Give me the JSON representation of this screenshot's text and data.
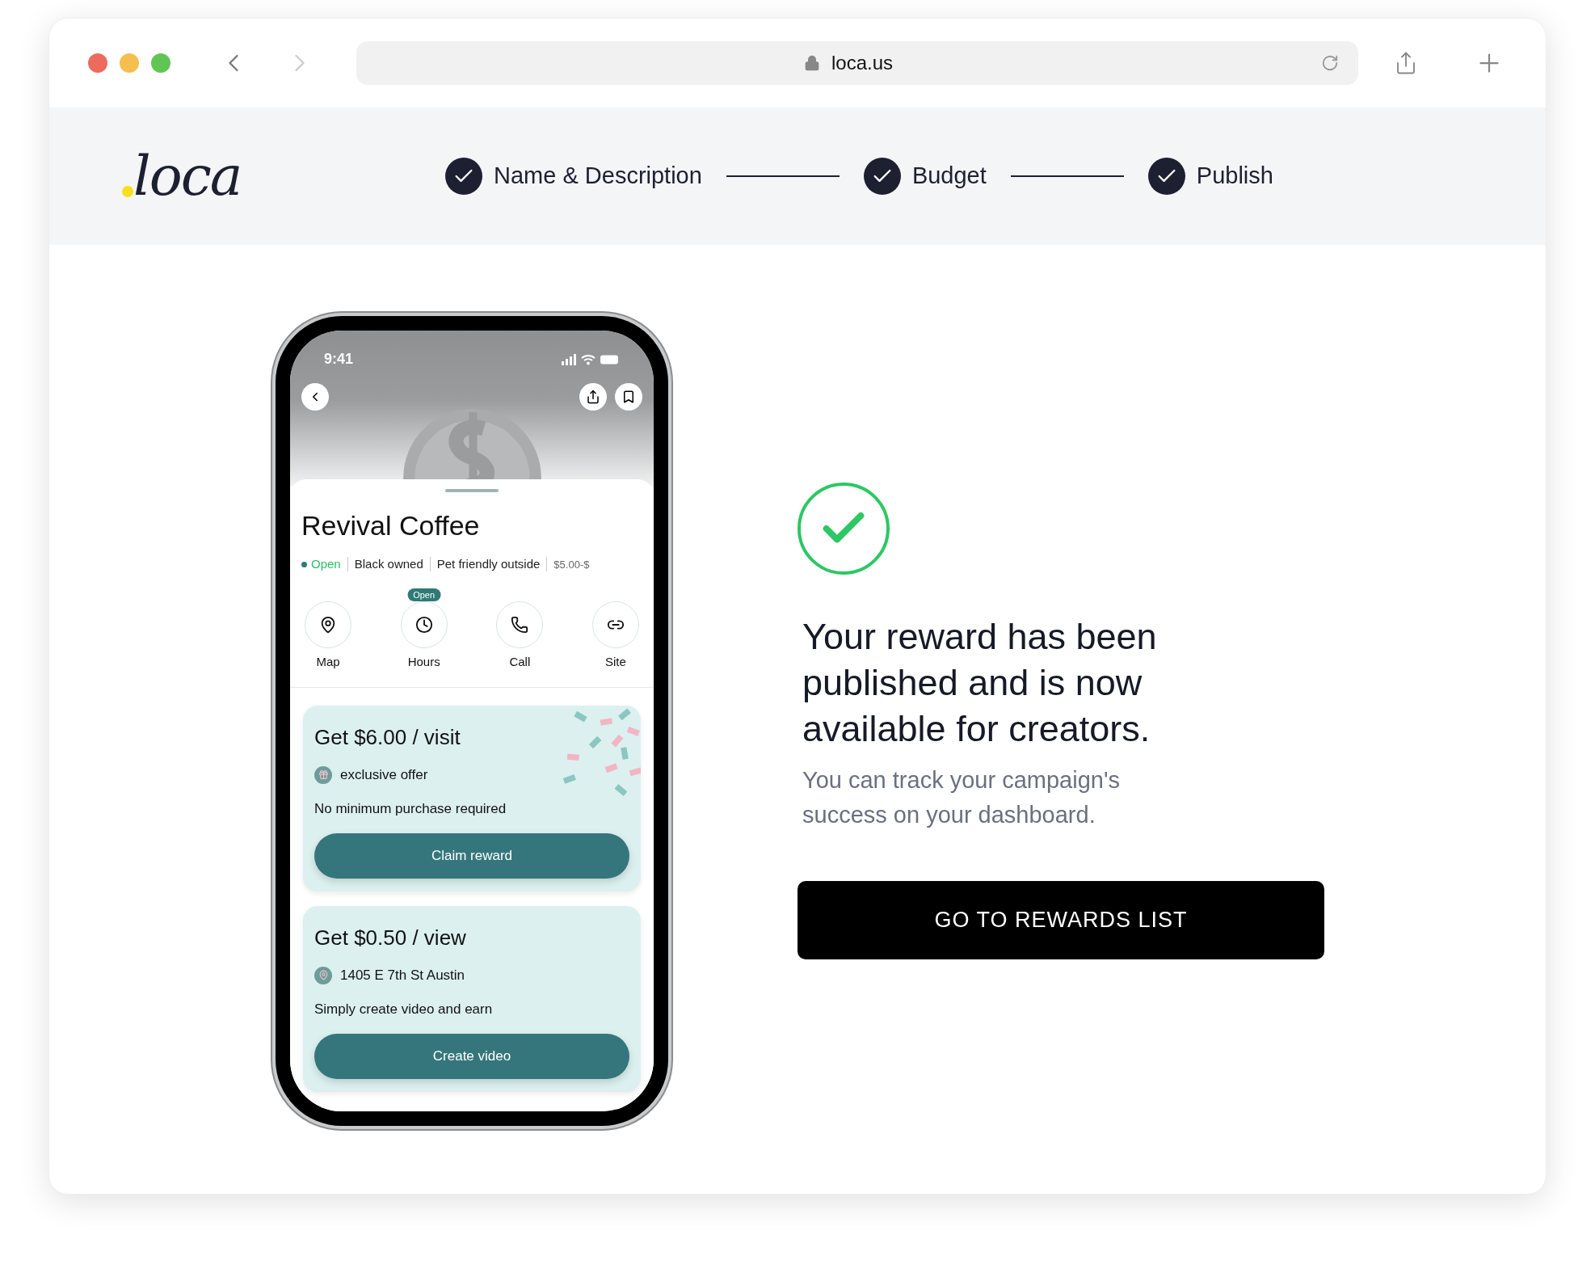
{
  "browser": {
    "url": "loca.us"
  },
  "logo": "loca",
  "steps": [
    {
      "label": "Name & Description",
      "completed": true
    },
    {
      "label": "Budget",
      "completed": true
    },
    {
      "label": "Publish",
      "completed": true
    }
  ],
  "phone": {
    "time": "9:41",
    "business": "Revival Coffee",
    "tags": [
      {
        "label": "Open",
        "kind": "status"
      },
      {
        "label": "Black owned",
        "kind": "tag"
      },
      {
        "label": "Pet friendly outside",
        "kind": "tag"
      },
      {
        "label": "$5.00-$",
        "kind": "price"
      }
    ],
    "actions": [
      {
        "label": "Map",
        "kind": "map"
      },
      {
        "label": "Hours",
        "kind": "hours",
        "badge": "Open"
      },
      {
        "label": "Call",
        "kind": "call"
      },
      {
        "label": "Site",
        "kind": "site"
      }
    ],
    "offers": [
      {
        "title": "Get $6.00 / visit",
        "detail": "exclusive offer",
        "kind": "gift",
        "note": "No minimum purchase required",
        "button": "Claim reward",
        "confetti": true
      },
      {
        "title": "Get $0.50 / view",
        "detail": "1405 E 7th St Austin",
        "kind": "pin",
        "note": "Simply create video and earn",
        "button": "Create video",
        "confetti": false
      }
    ]
  },
  "success": {
    "heading": "Your reward has been published and is now available for creators.",
    "body": "You can track your campaign's success on your dashboard.",
    "button": "GO TO REWARDS LIST"
  }
}
